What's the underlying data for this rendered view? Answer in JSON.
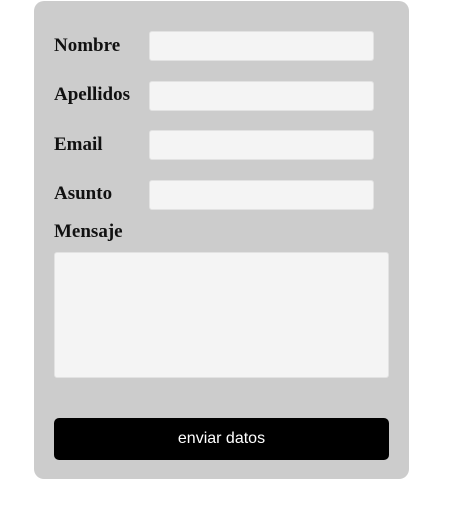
{
  "form": {
    "fields": {
      "nombre": {
        "label": "Nombre",
        "value": "",
        "placeholder": ""
      },
      "apellidos": {
        "label": "Apellidos",
        "value": "",
        "placeholder": ""
      },
      "email": {
        "label": "Email",
        "value": "",
        "placeholder": ""
      },
      "asunto": {
        "label": "Asunto",
        "value": "",
        "placeholder": ""
      }
    },
    "mensaje": {
      "label": "Mensaje",
      "value": "",
      "placeholder": ""
    },
    "submit_label": "enviar datos"
  },
  "colors": {
    "card_background": "#cccccc",
    "field_background": "#f4f4f4",
    "button_background": "#000000",
    "button_text": "#ffffff"
  }
}
